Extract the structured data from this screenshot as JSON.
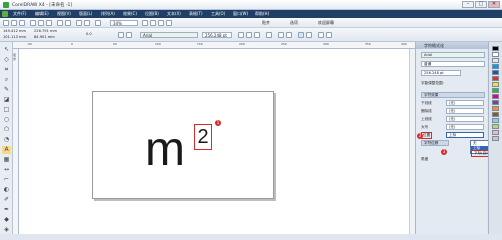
{
  "window": {
    "title": "CorelDRAW X4 - [未命名 -1]",
    "min_label": "–",
    "max_label": "□",
    "close_label": "✕"
  },
  "menu": [
    "文件(F)",
    "编辑(E)",
    "视图(V)",
    "版面(L)",
    "排列(A)",
    "效果(C)",
    "位图(B)",
    "文本(X)",
    "表格(T)",
    "工具(O)",
    "窗口(W)",
    "帮助(H)"
  ],
  "toolbar": {
    "zoom": "34%",
    "snap_label": "贴齐",
    "options_label": "选项",
    "welcome_label": "欢迎屏幕"
  },
  "property_bar": {
    "x": "149.412 mm",
    "y": "101.113 mm",
    "width": "226.791 mm",
    "height": "84.901 mm",
    "angle": "0.0",
    "font": "Arial",
    "font_size": "256.248 pt"
  },
  "ruler": {
    "h_numbers": [
      "-50",
      "0",
      "50",
      "100",
      "150",
      "200",
      "250",
      "300",
      "350",
      "400"
    ],
    "unit": "毫米"
  },
  "canvas": {
    "base_text": "m",
    "superscript_text": "2",
    "marker_1": "1"
  },
  "docker": {
    "title": "字符格式化",
    "font_value": "Arial",
    "style_value": "普通",
    "size_value": "256.248 pt",
    "range_label": "字距调整范围:",
    "effects_section": "字符效果",
    "rows": [
      {
        "label": "下划线",
        "value": "(无)"
      },
      {
        "label": "删除线",
        "value": "(无)"
      },
      {
        "label": "上划线",
        "value": "(无)"
      },
      {
        "label": "大写",
        "value": "(无)"
      },
      {
        "label": "位置",
        "value": "上标"
      }
    ],
    "shift_section": "字符位移",
    "extra_label": "角度",
    "marker_2": "2",
    "marker_3": "3",
    "dropdown_options": [
      "无",
      "上标",
      "下标(自动)"
    ],
    "dropdown_selected": "上标"
  },
  "colors": {
    "menubar": "#1f3f66",
    "marker": "#d92b2b",
    "palette": [
      "#000000",
      "#ffffff",
      "#e5e5e5",
      "#00a0e0",
      "#1a57b5",
      "#e62e2e",
      "#f7e21b",
      "#2eb34a",
      "#e4007f",
      "#7a3fa0",
      "#ff8c1a",
      "#8b5a2b",
      "#7fd3f0",
      "#b0d96b",
      "#f5b3c8",
      "#c8c8c8"
    ]
  }
}
